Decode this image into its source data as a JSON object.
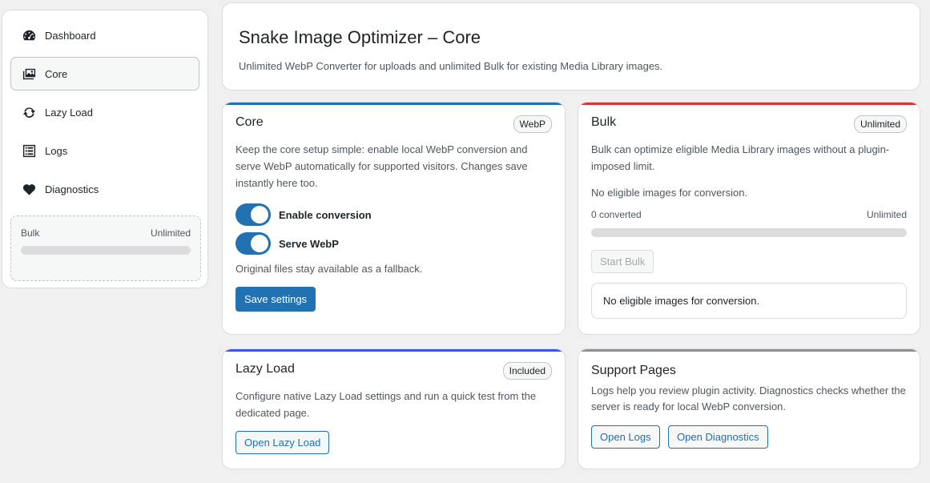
{
  "sidebar": {
    "items": [
      {
        "label": "Dashboard",
        "icon": "dashboard-icon"
      },
      {
        "label": "Core",
        "icon": "images-icon"
      },
      {
        "label": "Lazy Load",
        "icon": "update-icon"
      },
      {
        "label": "Logs",
        "icon": "list-icon"
      },
      {
        "label": "Diagnostics",
        "icon": "heart-icon"
      }
    ],
    "active_index": 1,
    "bulk": {
      "label": "Bulk",
      "value": "Unlimited",
      "progress": 0
    }
  },
  "header": {
    "title": "Snake Image Optimizer – Core",
    "subtitle": "Unlimited WebP Converter for uploads and unlimited Bulk for existing Media Library images."
  },
  "core_card": {
    "title": "Core",
    "badge": "WebP",
    "accent": "#2271b1",
    "description": "Keep the core setup simple: enable local WebP conversion and serve WebP automatically for supported visitors. Changes save instantly here too.",
    "toggles": [
      {
        "label": "Enable conversion",
        "on": true
      },
      {
        "label": "Serve WebP",
        "on": true
      }
    ],
    "note": "Original files stay available as a fallback.",
    "save_label": "Save settings"
  },
  "bulk_card": {
    "title": "Bulk",
    "badge": "Unlimited",
    "accent": "#d63638",
    "description": "Bulk can optimize eligible Media Library images without a plugin-imposed limit.",
    "status": "No eligible images for conversion.",
    "converted": "0 converted",
    "limit": "Unlimited",
    "progress": 0,
    "start_label": "Start Bulk",
    "notice": "No eligible images for conversion."
  },
  "lazy_card": {
    "title": "Lazy Load",
    "badge": "Included",
    "accent": "#3858e9",
    "description": "Configure native Lazy Load settings and run a quick test from the dedicated page.",
    "button_label": "Open Lazy Load"
  },
  "support_card": {
    "title": "Support Pages",
    "accent": "#8c8f94",
    "description": "Logs help you review plugin activity. Diagnostics checks whether the server is ready for local WebP conversion.",
    "logs_label": "Open Logs",
    "diagnostics_label": "Open Diagnostics"
  }
}
